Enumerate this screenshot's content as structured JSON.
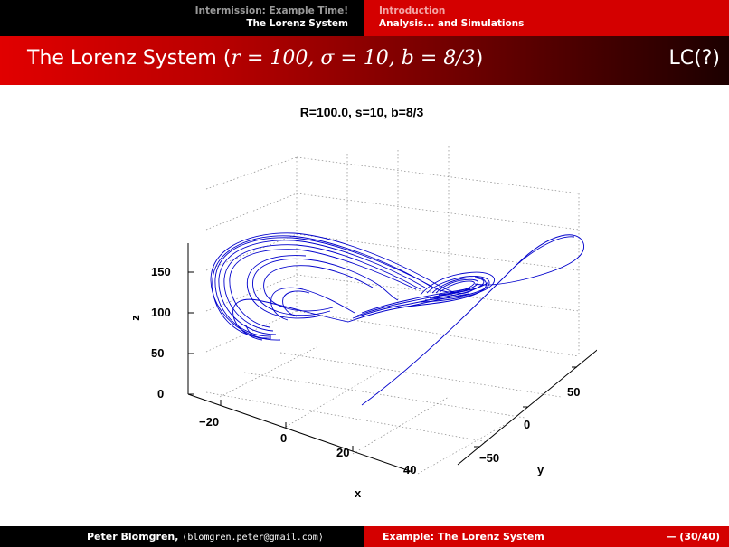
{
  "nav": {
    "left": [
      "Intermission: Example Time!",
      "The Lorenz System"
    ],
    "right": [
      "Introduction",
      "Analysis... and Simulations"
    ]
  },
  "slide": {
    "title_prefix": "The Lorenz System (",
    "title_math": "r = 100, σ = 10, b = 8/3",
    "title_suffix": ")",
    "label": "LC(?)"
  },
  "chart_data": {
    "type": "line",
    "title": "R=100.0,  s=10,  b=8/3",
    "xlabel": "x",
    "ylabel": "y",
    "zlabel": "z",
    "x_ticks": [
      "−20",
      "0",
      "20",
      "40"
    ],
    "y_ticks": [
      "−50",
      "0",
      "50"
    ],
    "z_ticks": [
      "0",
      "50",
      "100",
      "150"
    ],
    "grid": true,
    "series": [
      {
        "color": "#0000cc",
        "description": "Lorenz attractor trajectory in 3D (r=100, sigma=10, b=8/3)"
      }
    ]
  },
  "footer": {
    "author": "Peter Blomgren,",
    "email": "⟨blomgren.peter@gmail.com⟩",
    "section": "Example: The Lorenz System",
    "page": "— (30/40)"
  }
}
